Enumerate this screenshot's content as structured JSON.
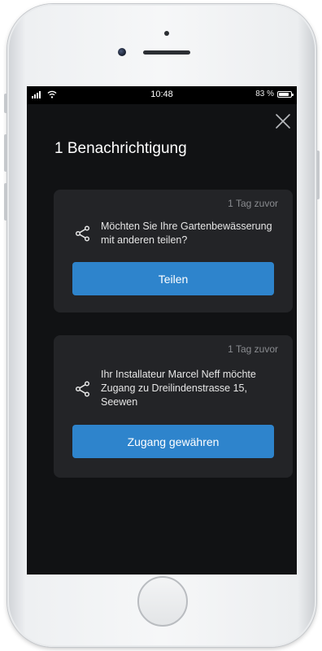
{
  "status_bar": {
    "time": "10:48",
    "battery": "83 %",
    "battery_level": 0.83
  },
  "header": {
    "title": "1 Benachrichtigung",
    "close_icon": "close-icon"
  },
  "notifications": [
    {
      "time_ago": "1 Tag zuvor",
      "icon": "share-icon",
      "message": "Möchten Sie Ihre Gartenbewässerung mit anderen teilen?",
      "action_label": "Teilen"
    },
    {
      "time_ago": "1 Tag zuvor",
      "icon": "share-icon",
      "message": "Ihr Installateur Marcel Neff möchte Zugang zu Dreilindenstrasse 15, Seewen",
      "action_label": "Zugang gewähren"
    }
  ],
  "colors": {
    "background": "#111214",
    "card": "#232427",
    "accent": "#2e84cc",
    "text": "#ffffff",
    "muted": "#8a8c90"
  }
}
